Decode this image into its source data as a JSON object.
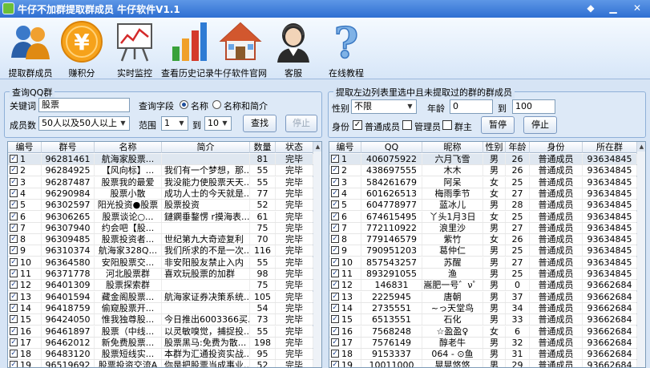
{
  "window": {
    "title": "牛仔不加群提取群成员  牛仔软件V1.1"
  },
  "toolbar": {
    "items": [
      {
        "label": "提取群成员",
        "icon": "users-icon"
      },
      {
        "label": "赚积分",
        "icon": "coin-yuan-icon"
      },
      {
        "label": "实时监控",
        "icon": "chart-board-icon"
      },
      {
        "label": "查看历史记录",
        "icon": "bar-chart-icon"
      },
      {
        "label": "牛仔软件官网",
        "icon": "house-icon"
      },
      {
        "label": "客服",
        "icon": "support-agent-icon"
      },
      {
        "label": "在线教程",
        "icon": "help-question-icon"
      }
    ]
  },
  "query": {
    "title": "查询QQ群",
    "keyword_label": "关键词",
    "keyword_value": "股票",
    "field_label": "查询字段",
    "field_options": [
      "名称",
      "名称和简介"
    ],
    "members_label": "成员数",
    "members_value": "50人以及50人以上",
    "range_label": "范围",
    "range_from": "1",
    "range_to_label": "到",
    "range_to": "10",
    "search_button": "查找",
    "stop_button": "停止"
  },
  "extract": {
    "title": "提取左边列表里选中且未提取过的群的群成员",
    "gender_label": "性别",
    "gender_value": "不限",
    "age_label": "年龄",
    "age_from": "0",
    "age_to_label": "到",
    "age_to": "100",
    "identity_label": "身份",
    "identity_options": [
      "普通成员",
      "管理员",
      "群主"
    ],
    "pause_button": "暂停",
    "stop_button": "停止"
  },
  "groups_table": {
    "columns": [
      "编号",
      "群号",
      "名称",
      "简介",
      "数量",
      "状态"
    ],
    "rows": [
      [
        "1",
        "96281461",
        "航海家股票...",
        "",
        "81",
        "完毕"
      ],
      [
        "2",
        "96284925",
        "【风向标】...",
        "我们有一个梦想，那...",
        "55",
        "完毕"
      ],
      [
        "3",
        "96287487",
        "股票我的最爱",
        "我没能力使股票天天...",
        "55",
        "完毕"
      ],
      [
        "4",
        "96290984",
        "股票小散",
        "成功人士的今天就是...",
        "77",
        "完毕"
      ],
      [
        "5",
        "96302597",
        "阳光投资●股票",
        "股票投资",
        "52",
        "完毕"
      ],
      [
        "6",
        "96306265",
        "股票谈论○...",
        "鏈鐦垂鍪愣 r摸海表...",
        "61",
        "完毕"
      ],
      [
        "7",
        "96307940",
        "约会吧【股...",
        "",
        "75",
        "完毕"
      ],
      [
        "8",
        "96309485",
        "股票投资者...",
        "世纪第九大奇迹复利",
        "70",
        "完毕"
      ],
      [
        "9",
        "96310374",
        "航海家328Q...",
        "我们所求的不是一次...",
        "116",
        "完毕"
      ],
      [
        "10",
        "96364580",
        "安阳股票交...",
        "非安阳股友禁止入内",
        "55",
        "完毕"
      ],
      [
        "11",
        "96371778",
        "河北股票群",
        "喜欢玩股票的加群",
        "98",
        "完毕"
      ],
      [
        "12",
        "96401309",
        "股票探索群",
        "",
        "75",
        "完毕"
      ],
      [
        "13",
        "96401594",
        "藏金阁股票...",
        "航海家证券决策系统...",
        "105",
        "完毕"
      ],
      [
        "14",
        "96418759",
        "偷窥股票开...",
        "",
        "54",
        "完毕"
      ],
      [
        "15",
        "96424050",
        "惟我独尊股...",
        "今日推出6003366买...",
        "73",
        "完毕"
      ],
      [
        "16",
        "96461897",
        "股票（中线...",
        "以灵敏嗅觉，捕捉投...",
        "55",
        "完毕"
      ],
      [
        "17",
        "96462012",
        "新免费股票...",
        "股票黑马:免费为散...",
        "198",
        "完毕"
      ],
      [
        "18",
        "96483120",
        "股票短线实...",
        "本群为汇通投资实战...",
        "95",
        "完毕"
      ],
      [
        "19",
        "96519692",
        "股票投资交流A",
        "你是把股票当成事业...",
        "52",
        "完毕"
      ]
    ]
  },
  "members_table": {
    "columns": [
      "编号",
      "QQ",
      "昵称",
      "性别",
      "年龄",
      "身份",
      "所在群"
    ],
    "rows": [
      [
        "1",
        "406075922",
        "六月飞雪",
        "男",
        "26",
        "普通成员",
        "93634845"
      ],
      [
        "2",
        "438697555",
        "木木",
        "男",
        "26",
        "普通成员",
        "93634845"
      ],
      [
        "3",
        "584261679",
        "阿呆",
        "女",
        "25",
        "普通成员",
        "93634845"
      ],
      [
        "4",
        "601626513",
        "梅雨季节",
        "女",
        "27",
        "普通成员",
        "93634845"
      ],
      [
        "5",
        "604778977",
        "蓝冰儿",
        "男",
        "28",
        "普通成员",
        "93634845"
      ],
      [
        "6",
        "674615495",
        "丫头1月3日",
        "女",
        "25",
        "普通成员",
        "93634845"
      ],
      [
        "7",
        "772110922",
        "浪里沙",
        "男",
        "27",
        "普通成员",
        "93634845"
      ],
      [
        "8",
        "779146579",
        "紫竹",
        "女",
        "26",
        "普通成员",
        "93634845"
      ],
      [
        "9",
        "790951203",
        "葛仲仁",
        "男",
        "25",
        "普通成员",
        "93634845"
      ],
      [
        "10",
        "857543257",
        "苏醒",
        "男",
        "27",
        "普通成员",
        "93634845"
      ],
      [
        "11",
        "893291055",
        "渔",
        "男",
        "25",
        "普通成员",
        "93634845"
      ],
      [
        "12",
        "146831",
        "嵩肥一号゛ν゜",
        "男",
        "0",
        "普通成员",
        "93662684"
      ],
      [
        "13",
        "2225945",
        "唐朝",
        "男",
        "37",
        "普通成员",
        "93662684"
      ],
      [
        "14",
        "2735551",
        "~っ天堂鸟",
        "男",
        "34",
        "普通成员",
        "93662684"
      ],
      [
        "15",
        "6513551",
        "石化",
        "男",
        "33",
        "普通成员",
        "93662684"
      ],
      [
        "16",
        "7568248",
        "☆盈盈♀",
        "女",
        "6",
        "普通成员",
        "93662684"
      ],
      [
        "17",
        "7576149",
        "醇老牛",
        "男",
        "32",
        "普通成员",
        "93662684"
      ],
      [
        "18",
        "9153337",
        "064 - ⊙鱼",
        "男",
        "31",
        "普通成员",
        "93662684"
      ],
      [
        "19",
        "10011000",
        "晃晃悠悠",
        "男",
        "29",
        "普通成员",
        "93662684"
      ]
    ]
  },
  "colors": {
    "titlebar": "#2f6fd2",
    "panel": "#d6e4f5",
    "accent": "#1f4e9a"
  }
}
